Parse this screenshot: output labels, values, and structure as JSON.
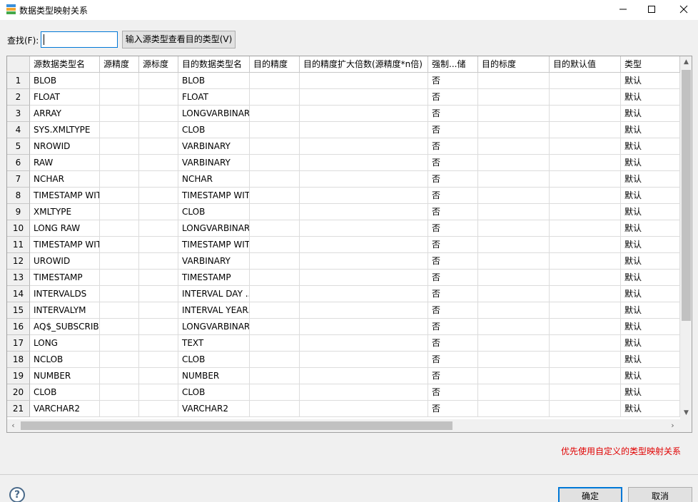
{
  "window": {
    "title": "数据类型映射关系",
    "controls": {
      "minimize": "—",
      "maximize": "☐",
      "close": "✕"
    }
  },
  "search": {
    "label": "查找(F):",
    "value": "",
    "lookup_button": "输入源类型查看目的类型(V)"
  },
  "table": {
    "columns": [
      "",
      "源数据类型名",
      "源精度",
      "源标度",
      "目的数据类型名",
      "目的精度",
      "目的精度扩大倍数(源精度*n倍)",
      "强制...储",
      "目的标度",
      "目的默认值",
      "类型"
    ],
    "rows": [
      [
        "1",
        "BLOB",
        "",
        "",
        "BLOB",
        "",
        "",
        "否",
        "",
        "",
        "默认"
      ],
      [
        "2",
        "FLOAT",
        "",
        "",
        "FLOAT",
        "",
        "",
        "否",
        "",
        "",
        "默认"
      ],
      [
        "3",
        "ARRAY",
        "",
        "",
        "LONGVARBINARY",
        "",
        "",
        "否",
        "",
        "",
        "默认"
      ],
      [
        "4",
        "SYS.XMLTYPE",
        "",
        "",
        "CLOB",
        "",
        "",
        "否",
        "",
        "",
        "默认"
      ],
      [
        "5",
        "NROWID",
        "",
        "",
        "VARBINARY",
        "",
        "",
        "否",
        "",
        "",
        "默认"
      ],
      [
        "6",
        "RAW",
        "",
        "",
        "VARBINARY",
        "",
        "",
        "否",
        "",
        "",
        "默认"
      ],
      [
        "7",
        "NCHAR",
        "",
        "",
        "NCHAR",
        "",
        "",
        "否",
        "",
        "",
        "默认"
      ],
      [
        "8",
        "TIMESTAMP WIT",
        "",
        "",
        "TIMESTAMP WIT",
        "",
        "",
        "否",
        "",
        "",
        "默认"
      ],
      [
        "9",
        "XMLTYPE",
        "",
        "",
        "CLOB",
        "",
        "",
        "否",
        "",
        "",
        "默认"
      ],
      [
        "10",
        "LONG RAW",
        "",
        "",
        "LONGVARBINARY",
        "",
        "",
        "否",
        "",
        "",
        "默认"
      ],
      [
        "11",
        "TIMESTAMP WIT",
        "",
        "",
        "TIMESTAMP WIT",
        "",
        "",
        "否",
        "",
        "",
        "默认"
      ],
      [
        "12",
        "UROWID",
        "",
        "",
        "VARBINARY",
        "",
        "",
        "否",
        "",
        "",
        "默认"
      ],
      [
        "13",
        "TIMESTAMP",
        "",
        "",
        "TIMESTAMP",
        "",
        "",
        "否",
        "",
        "",
        "默认"
      ],
      [
        "14",
        "INTERVALDS",
        "",
        "",
        "INTERVAL DAY ...",
        "",
        "",
        "否",
        "",
        "",
        "默认"
      ],
      [
        "15",
        "INTERVALYM",
        "",
        "",
        "INTERVAL YEAR...",
        "",
        "",
        "否",
        "",
        "",
        "默认"
      ],
      [
        "16",
        "AQ$_SUBSCRIBE",
        "",
        "",
        "LONGVARBINARY",
        "",
        "",
        "否",
        "",
        "",
        "默认"
      ],
      [
        "17",
        "LONG",
        "",
        "",
        "TEXT",
        "",
        "",
        "否",
        "",
        "",
        "默认"
      ],
      [
        "18",
        "NCLOB",
        "",
        "",
        "CLOB",
        "",
        "",
        "否",
        "",
        "",
        "默认"
      ],
      [
        "19",
        "NUMBER",
        "",
        "",
        "NUMBER",
        "",
        "",
        "否",
        "",
        "",
        "默认"
      ],
      [
        "20",
        "CLOB",
        "",
        "",
        "CLOB",
        "",
        "",
        "否",
        "",
        "",
        "默认"
      ],
      [
        "21",
        "VARCHAR2",
        "",
        "",
        "VARCHAR2",
        "",
        "",
        "否",
        "",
        "",
        "默认"
      ]
    ]
  },
  "hint": "优先使用自定义的类型映射关系",
  "buttons": {
    "ok": "确定",
    "cancel": "取消",
    "help": "?"
  },
  "colors": {
    "accent": "#0078d7",
    "hint": "#e00000"
  }
}
